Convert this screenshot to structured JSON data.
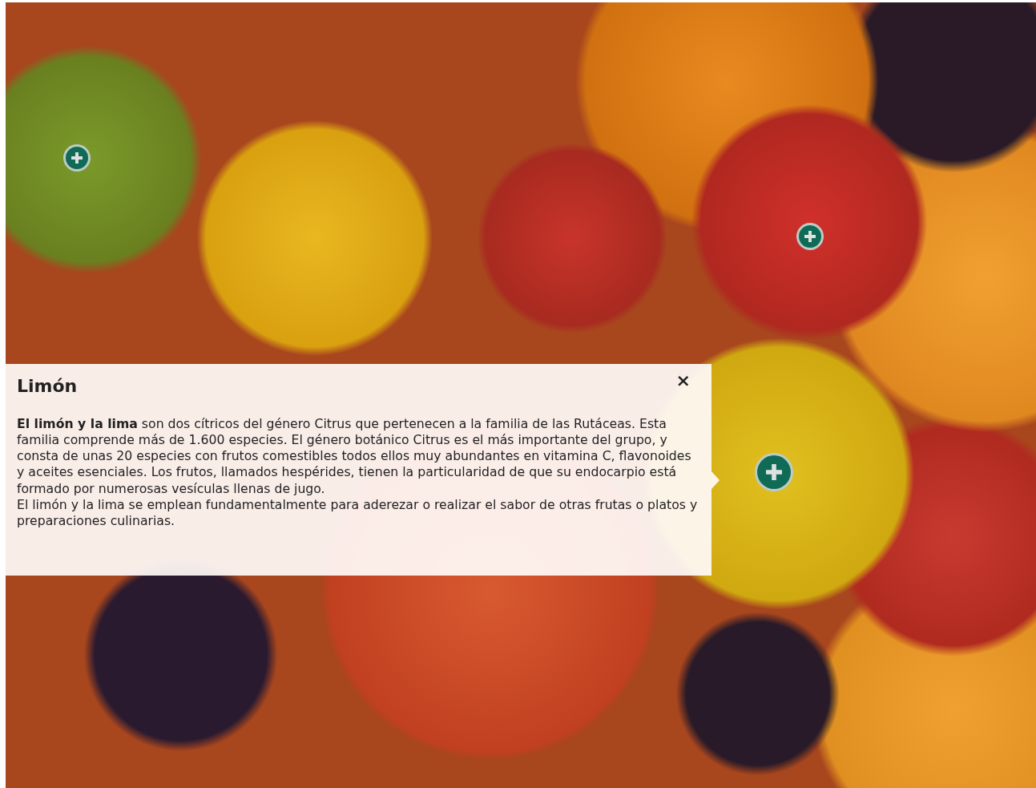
{
  "hotspots": [
    {
      "selected": false
    },
    {
      "selected": false
    },
    {
      "selected": true
    }
  ],
  "popup": {
    "title": "Limón",
    "close": "×",
    "paragraphs": [
      "**El limón y la lima** son dos cítricos del género Citrus que pertenecen a la familia de las Rutáceas. Esta familia comprende más de 1.600 especies. El género botánico Citrus es el más importante del grupo, y consta de unas 20 especies con frutos comestibles todos ellos muy abundantes en vitamina C, flavonoides y aceites esenciales. Los frutos, llamados hespérides, tienen la particularidad de que su endocarpio está formado por numerosas vesículas llenas de jugo.",
      "El limón y la lima se emplean fundamentalmente para aderezar o realizar el sabor de otras frutas o platos y preparaciones culinarias."
    ]
  }
}
